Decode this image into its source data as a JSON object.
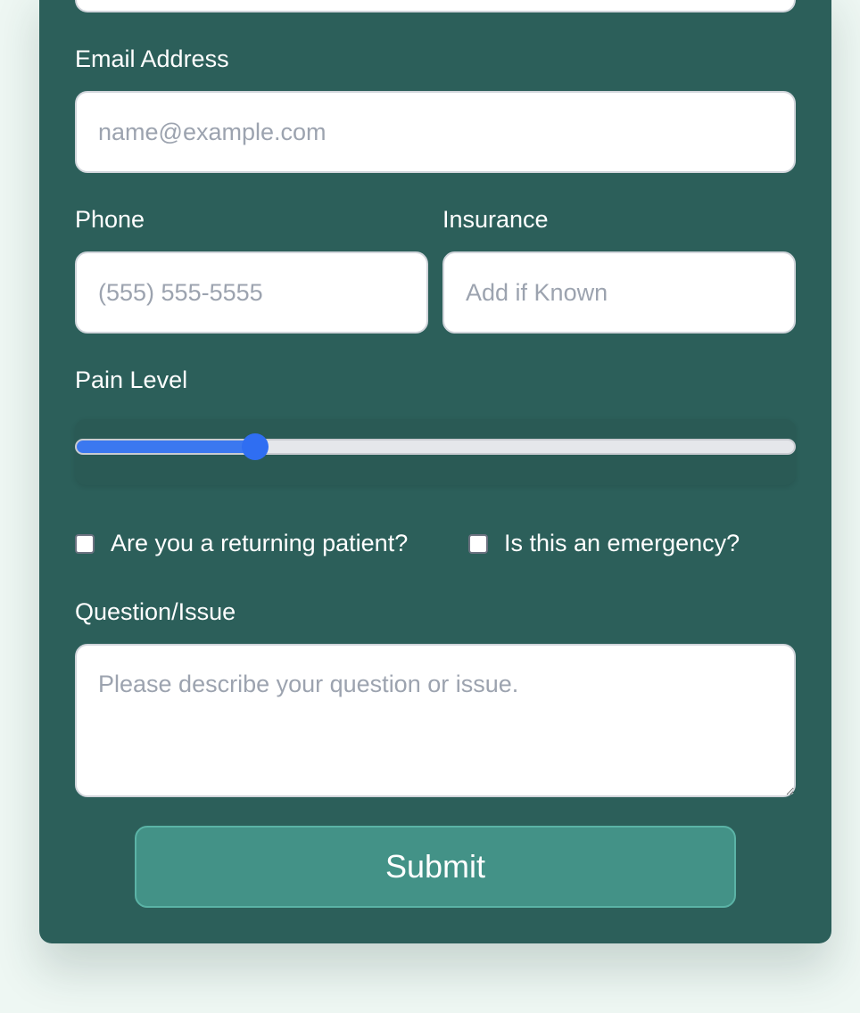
{
  "form": {
    "email": {
      "label": "Email Address",
      "placeholder": "name@example.com"
    },
    "phone": {
      "label": "Phone",
      "placeholder": "(555) 555-5555"
    },
    "insurance": {
      "label": "Insurance",
      "placeholder": "Add if Known"
    },
    "pain_level": {
      "label": "Pain Level",
      "value_fraction": 0.25
    },
    "returning_patient": {
      "label": "Are you a returning patient?",
      "checked": false
    },
    "emergency": {
      "label": "Is this an emergency?",
      "checked": false
    },
    "question": {
      "label": "Question/Issue",
      "placeholder": "Please describe your question or issue."
    },
    "submit_label": "Submit"
  },
  "colors": {
    "card_background": "#2c5f5a",
    "page_background": "#eef7f3",
    "submit_button": "#439287",
    "slider_accent": "#3b78f0"
  }
}
